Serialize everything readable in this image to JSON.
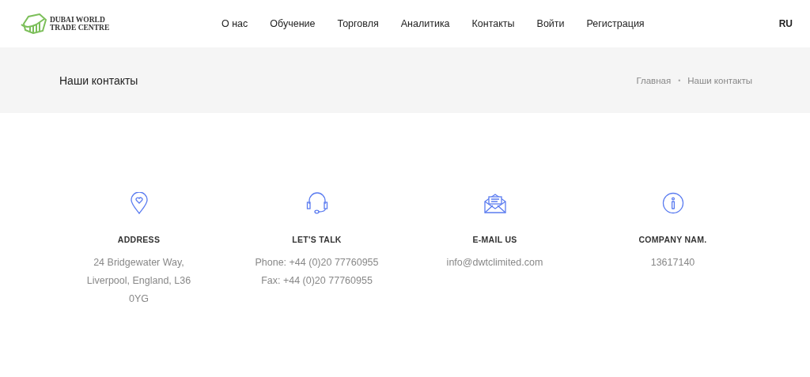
{
  "logo": {
    "lines": [
      "DUBAI WORLD",
      "TRADE CENTRE"
    ]
  },
  "nav": [
    {
      "label": "О нас"
    },
    {
      "label": "Обучение"
    },
    {
      "label": "Торговля"
    },
    {
      "label": "Аналитика"
    },
    {
      "label": "Контакты"
    },
    {
      "label": "Войти"
    },
    {
      "label": "Регистрация"
    }
  ],
  "language": {
    "label": "RU",
    "selected": true
  },
  "page_title": "Наши контакты",
  "breadcrumbs": [
    {
      "label": "Главная"
    },
    {
      "label": "Наши контакты"
    }
  ],
  "breadcrumb_separator": "•",
  "contacts": [
    {
      "kind": "pin",
      "title": "ADDRESS",
      "lines": [
        "24 Bridgewater Way, Liverpool, England, L36 0YG"
      ]
    },
    {
      "kind": "headset",
      "title": "LET'S TALK",
      "lines": [
        "Phone: +44 (0)20 77760955",
        "Fax: +44 (0)20 77760955"
      ]
    },
    {
      "kind": "mail",
      "title": "E-MAIL US",
      "lines": [
        "info@dwtclimited.com"
      ]
    },
    {
      "kind": "info",
      "title": "COMPANY NAM.",
      "lines": [
        "13617140"
      ]
    }
  ]
}
